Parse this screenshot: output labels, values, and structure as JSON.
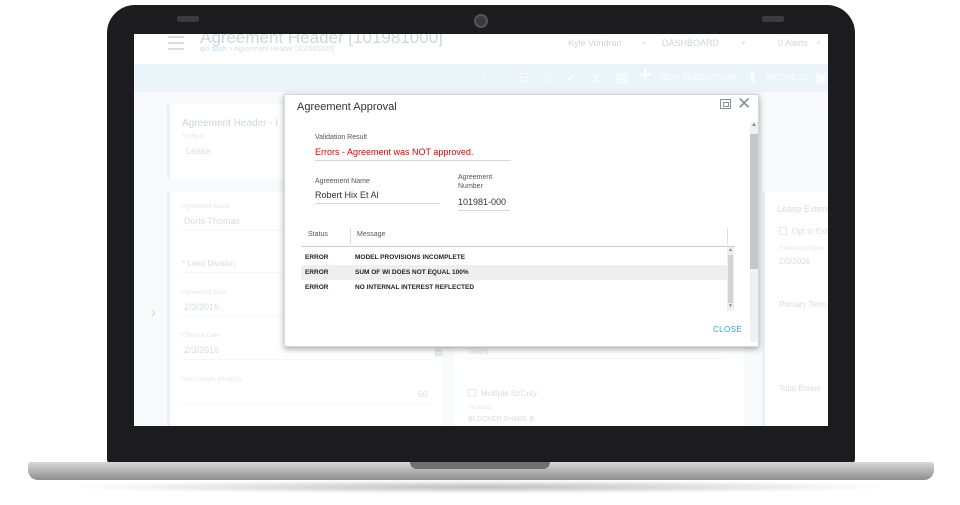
{
  "app": {
    "title": "Agreement Header [101981000]",
    "breadcrumb_home": "qio dash",
    "breadcrumb_rest": "> Agreement Header [101981000]",
    "user": "Kyle Vondran",
    "dashboard": "DASHBOARD",
    "alerts": "0 Alerts"
  },
  "toolbar": {
    "new_subdivision": "NEW SUBDIVISION",
    "retrieve": "RETRIEVE"
  },
  "background_form": {
    "panel_title": "Agreement Header - I",
    "subject_label": "*Subject",
    "subject_value": "Lease",
    "agreement_name_label": "*Agreement Name",
    "agreement_name_value": "Doris Thomas",
    "land_division_label": "* Land Division",
    "agreement_date_label": "*Agreement Date",
    "agreement_date_value": "2/3/2016",
    "effective_date_label": "*Effective Date",
    "effective_date_value": "2/3/2016",
    "term_length_label": "*Term Length (Months)",
    "term_length_value": "60",
    "grant_value": "Grant",
    "multiple_st_cnty": "Multiple St/Cnty",
    "prospect_label": "Prospect",
    "prospect_value": "BLOCKER SHARE B",
    "lease_extension": "Lease Extens",
    "opt_to_ext": "Opt to Ext",
    "extension_label": "Extension Expira",
    "extension_value": "2/3/2026",
    "primary_term": "Primary Term",
    "total_bonus": "Total Bonus"
  },
  "modal": {
    "title": "Agreement Approval",
    "validation_result_label": "Validation Result",
    "validation_result_value": "Errors - Agreement was NOT approved.",
    "agreement_name_label": "Agreement Name",
    "agreement_name_value": "Robert Hix Et Al",
    "agreement_number_label_1": "Agreement",
    "agreement_number_label_2": "Number",
    "agreement_number_value": "101981-000",
    "table": {
      "headers": [
        "Status",
        "Message"
      ],
      "rows": [
        {
          "status": "ERROR",
          "message": "MODEL PROVISIONS INCOMPLETE"
        },
        {
          "status": "ERROR",
          "message": "SUM OF WI DOES NOT EQUAL 100%"
        },
        {
          "status": "ERROR",
          "message": "NO INTERNAL INTEREST REFLECTED"
        }
      ]
    },
    "close_label": "CLOSE"
  },
  "colors": {
    "accent": "#2aa3dc",
    "error": "#e60000",
    "toolbar_bg": "#d7ecf8"
  }
}
